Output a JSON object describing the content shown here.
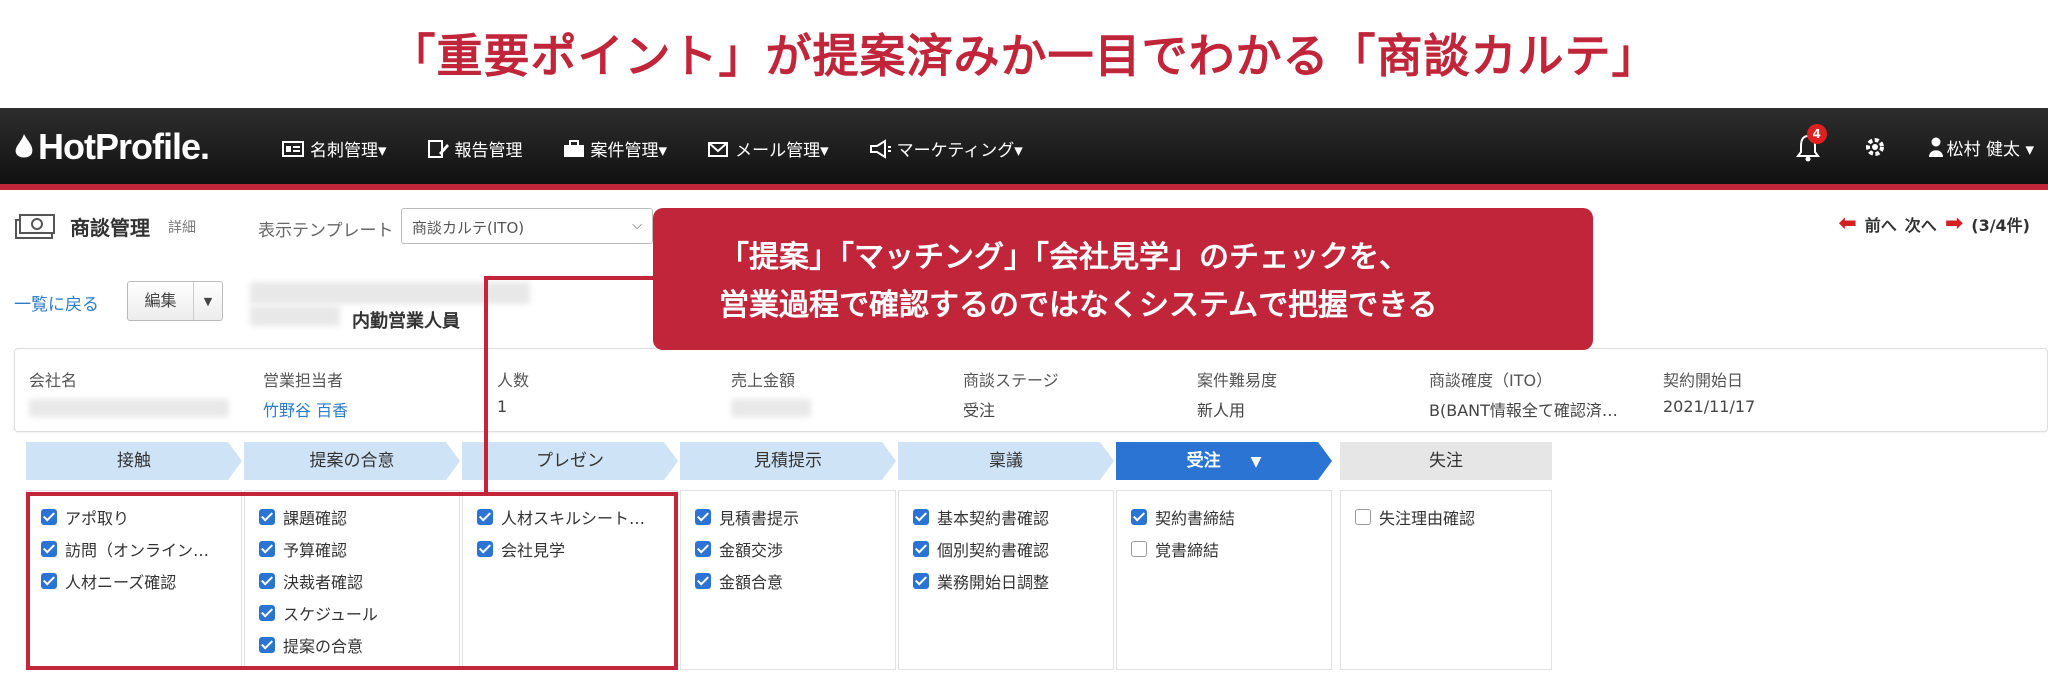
{
  "headline": "「重要ポイント」が提案済みか一目でわかる「商談カルテ」",
  "navbar": {
    "logo": "HotProfile.",
    "menu": [
      {
        "icon": "business-card-icon",
        "label": "名刺管理▾"
      },
      {
        "icon": "report-edit-icon",
        "label": "報告管理"
      },
      {
        "icon": "briefcase-icon",
        "label": "案件管理▾"
      },
      {
        "icon": "mail-icon",
        "label": "メール管理▾"
      },
      {
        "icon": "megaphone-icon",
        "label": "マーケティング▾"
      }
    ],
    "notification_count": "4",
    "user_name": "松村 健太 ▾"
  },
  "subheader": {
    "title": "商談管理",
    "subtitle": "詳細",
    "template_label": "表示テンプレート",
    "template_value": "商談カルテ(ITO)",
    "prev_label": "前へ",
    "next_label": "次へ",
    "count": "(3/4件)"
  },
  "actions": {
    "back_link": "一覧に戻る",
    "edit_label": "編集"
  },
  "department": "内勤営業人員",
  "info": [
    {
      "key": "会社名",
      "value": ""
    },
    {
      "key": "営業担当者",
      "value": "竹野谷 百香"
    },
    {
      "key": "人数",
      "value": "1"
    },
    {
      "key": "売上金額",
      "value": ""
    },
    {
      "key": "商談ステージ",
      "value": "受注"
    },
    {
      "key": "案件難易度",
      "value": "新人用"
    },
    {
      "key": "商談確度（ITO）",
      "value": "B(BANT情報全て確認済…"
    },
    {
      "key": "契約開始日",
      "value": "2021/11/17"
    }
  ],
  "stages": [
    {
      "label": "接触",
      "items": [
        {
          "label": "アポ取り",
          "checked": true
        },
        {
          "label": "訪問（オンライン…",
          "checked": true
        },
        {
          "label": "人材ニーズ確認",
          "checked": true
        }
      ]
    },
    {
      "label": "提案の合意",
      "items": [
        {
          "label": "課題確認",
          "checked": true
        },
        {
          "label": "予算確認",
          "checked": true
        },
        {
          "label": "決裁者確認",
          "checked": true
        },
        {
          "label": "スケジュール",
          "checked": true
        },
        {
          "label": "提案の合意",
          "checked": true
        }
      ]
    },
    {
      "label": "プレゼン",
      "items": [
        {
          "label": "人材スキルシート…",
          "checked": true
        },
        {
          "label": "会社見学",
          "checked": true
        }
      ]
    },
    {
      "label": "見積提示",
      "items": [
        {
          "label": "見積書提示",
          "checked": true
        },
        {
          "label": "金額交渉",
          "checked": true
        },
        {
          "label": "金額合意",
          "checked": true
        }
      ]
    },
    {
      "label": "稟議",
      "items": [
        {
          "label": "基本契約書確認",
          "checked": true
        },
        {
          "label": "個別契約書確認",
          "checked": true
        },
        {
          "label": "業務開始日調整",
          "checked": true
        }
      ]
    },
    {
      "label": "受注",
      "active": true,
      "items": [
        {
          "label": "契約書締結",
          "checked": true
        },
        {
          "label": "覚書締結",
          "checked": false
        }
      ]
    },
    {
      "label": "失注",
      "items": [
        {
          "label": "失注理由確認",
          "checked": false
        }
      ]
    }
  ],
  "callout": {
    "line1": "「提案」「マッチング」「会社見学」のチェックを、",
    "line2": "営業過程で確認するのではなくシステムで把握できる"
  },
  "colors": {
    "accent_red": "#c0253a",
    "active_blue": "#2c74d4",
    "stage_blue": "#cfe3f6",
    "link_blue": "#2c7bc9"
  }
}
